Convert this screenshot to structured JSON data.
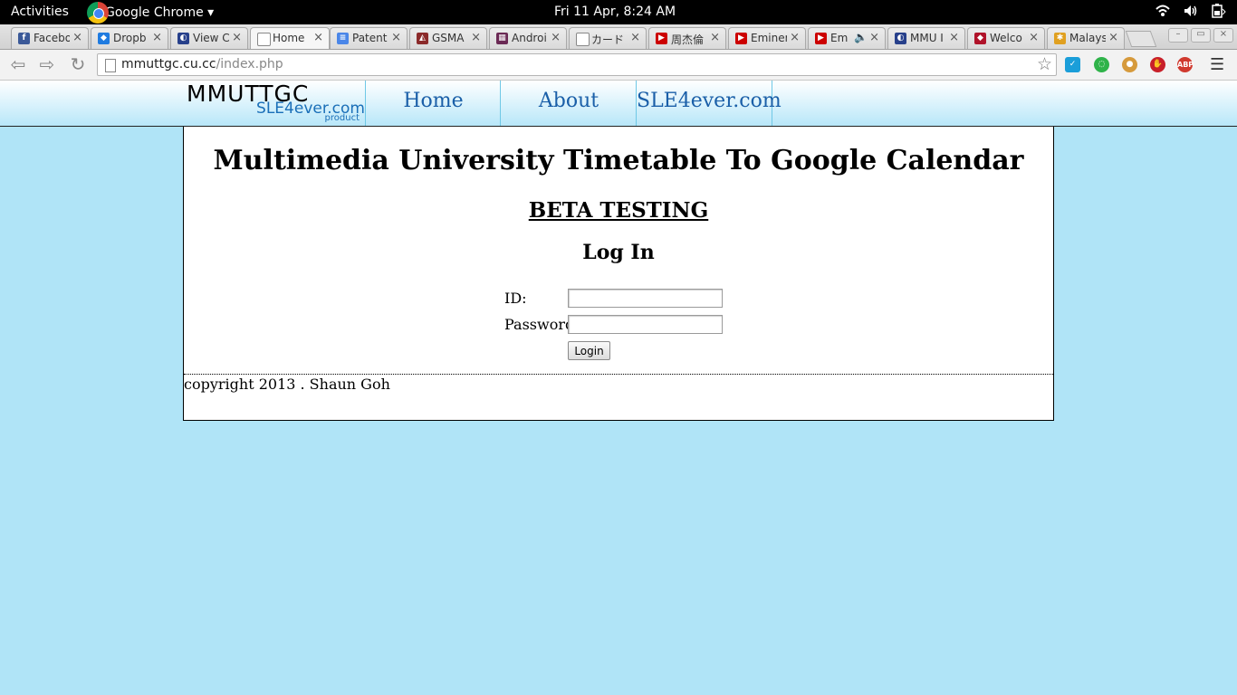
{
  "system_bar": {
    "activities": "Activities",
    "app_name": "Google Chrome ▾",
    "clock": "Fri 11 Apr,  8:24 AM"
  },
  "tabs": [
    {
      "title": "Facebo",
      "icon": "facebook-icon",
      "color": "#3b5998",
      "active": false
    },
    {
      "title": "Dropb",
      "icon": "dropbox-icon",
      "color": "#1f7be0",
      "active": false
    },
    {
      "title": "View C",
      "icon": "mmu-icon",
      "color": "#27408b",
      "active": false
    },
    {
      "title": "Home",
      "icon": "page-icon",
      "color": "#ffffff",
      "active": true
    },
    {
      "title": "Patent",
      "icon": "docs-icon",
      "color": "#4a86e8",
      "active": false
    },
    {
      "title": "GSMA",
      "icon": "gsma-icon",
      "color": "#8b2a2a",
      "active": false
    },
    {
      "title": "Androi",
      "icon": "android-icon",
      "color": "#6b2a55",
      "active": false
    },
    {
      "title": "カード",
      "icon": "page-icon",
      "color": "#ffffff",
      "active": false
    },
    {
      "title": "周杰倫",
      "icon": "youtube-icon",
      "color": "#cc0000",
      "active": false
    },
    {
      "title": "Eminem",
      "icon": "youtube-icon",
      "color": "#cc0000",
      "active": false
    },
    {
      "title": "Em",
      "icon": "youtube-icon",
      "color": "#cc0000",
      "active": false
    },
    {
      "title": "MMU I",
      "icon": "mmu-icon",
      "color": "#27408b",
      "active": false
    },
    {
      "title": "Welco",
      "icon": "welcome-icon",
      "color": "#b0132a",
      "active": false
    },
    {
      "title": "Malays",
      "icon": "pinwheel-icon",
      "color": "#e0a020",
      "active": false
    }
  ],
  "address_bar": {
    "host": "mmuttgc.cu.cc",
    "path": "/index.php"
  },
  "site_nav": {
    "logo_main": "MMUTTGC",
    "logo_sub": "SLE4ever.com",
    "logo_product": "product",
    "links": [
      "Home",
      "About",
      "SLE4ever.com"
    ]
  },
  "content": {
    "title": "Multimedia University Timetable To Google Calendar",
    "beta": "BETA TESTING",
    "login_heading": "Log In",
    "id_label": "ID:",
    "password_label": "Password:",
    "id_value": "",
    "password_value": "",
    "login_button": "Login",
    "footer": "copyright 2013 . Shaun Goh"
  }
}
